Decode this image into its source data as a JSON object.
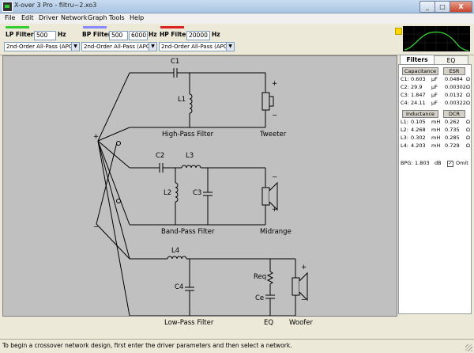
{
  "window": {
    "title": "X-over 3 Pro - filtru~2.xo3",
    "min": "_",
    "max": "□",
    "close": "X"
  },
  "menu": [
    "File",
    "Edit",
    "Driver",
    "Network",
    "Graph",
    "Tools",
    "Help"
  ],
  "filters": {
    "lp": {
      "label": "LP Filter:",
      "value": "500",
      "unit": "Hz",
      "type": "2nd-Order All-Pass (APC)",
      "color": "#33cc33"
    },
    "bp": {
      "label": "BP Filter:",
      "low": "500",
      "high": "6000",
      "unit": "Hz",
      "type": "2nd-Order All-Pass (APC)",
      "color": "#8888ff"
    },
    "hp": {
      "label": "HP Filter:",
      "value": "20000",
      "unit": "Hz",
      "type": "2nd-Order All-Pass (APC)",
      "color": "#dd2222"
    }
  },
  "schematic": {
    "components": {
      "c1": "C1",
      "c2": "C2",
      "c3": "C3",
      "c4": "C4",
      "l1": "L1",
      "l2": "L2",
      "l3": "L3",
      "l4": "L4",
      "req": "Req",
      "ce": "Ce"
    },
    "sections": {
      "hp": "High-Pass Filter",
      "bp": "Band-Pass Filter",
      "lp": "Low-Pass Filter",
      "eq": "EQ"
    },
    "drivers": {
      "tweeter": "Tweeter",
      "midrange": "Midrange",
      "woofer": "Woofer"
    },
    "signs": {
      "plus": "+",
      "minus": "−"
    }
  },
  "panel": {
    "tabs": [
      "Filters",
      "EQ"
    ],
    "cap_header": "Capacitance",
    "esr_header": "ESR",
    "caps": [
      {
        "n": "C1:",
        "v": "0.603",
        "u": "µF",
        "esr": "0.0484",
        "o": "Ω"
      },
      {
        "n": "C2:",
        "v": "29.9",
        "u": "µF",
        "esr": "0.00302",
        "o": "Ω"
      },
      {
        "n": "C3:",
        "v": "1.847",
        "u": "µF",
        "esr": "0.0132",
        "o": "Ω"
      },
      {
        "n": "C4:",
        "v": "24.11",
        "u": "µF",
        "esr": "0.00322",
        "o": "Ω"
      }
    ],
    "ind_header": "Inductance",
    "dcr_header": "DCR",
    "inds": [
      {
        "n": "L1:",
        "v": "0.105",
        "u": "mH",
        "dcr": "0.262",
        "o": "Ω"
      },
      {
        "n": "L2:",
        "v": "4.268",
        "u": "mH",
        "dcr": "0.735",
        "o": "Ω"
      },
      {
        "n": "L3:",
        "v": "0.302",
        "u": "mH",
        "dcr": "0.285",
        "o": "Ω"
      },
      {
        "n": "L4:",
        "v": "4.203",
        "u": "mH",
        "dcr": "0.729",
        "o": "Ω"
      }
    ],
    "bpg_label": "BPG:",
    "bpg_value": "1.803",
    "bpg_unit": "dB",
    "omit_label": "Omit",
    "omit_checked": true
  },
  "status": "To begin a crossover network design, first enter the driver parameters and then select a network."
}
